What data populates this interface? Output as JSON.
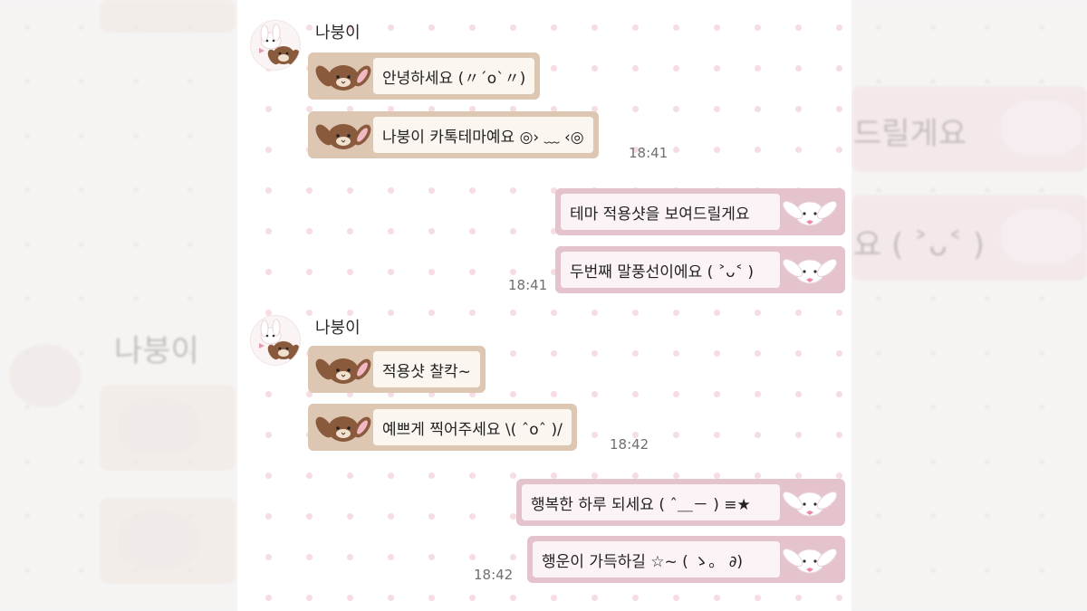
{
  "chat": {
    "groups": [
      {
        "sender": "나붕이",
        "messages": [
          {
            "text": "안녕하세요 (〃ˊoˋ〃)"
          },
          {
            "text": "나붕이 카톡테마예요 ◎› ﹏ ‹◎",
            "time": "18:41"
          }
        ]
      },
      {
        "sender": "me",
        "messages": [
          {
            "text": "테마 적용샷을 보여드릴게요"
          },
          {
            "text": "두번째 말풍선이에요 ( ˃ᴗ˂ )",
            "time": "18:41"
          }
        ]
      },
      {
        "sender": "나붕이",
        "messages": [
          {
            "text": "적용샷 찰칵~"
          },
          {
            "text": "예쁘게 찍어주세요 \\( ˆoˆ )/",
            "time": "18:42"
          }
        ]
      },
      {
        "sender": "me",
        "messages": [
          {
            "text": "행복한 하루 되세요 ( ˆ＿－ ) ≡★"
          },
          {
            "text": "행운이 가득하길 ☆~ ( ゝ。 ∂)",
            "time": "18:42"
          }
        ]
      }
    ]
  },
  "backdrop": {
    "left_name": "나붕이",
    "right_snippet_1": "드릴게요",
    "right_snippet_2": "요 ( ˃ᴗ˂ )"
  },
  "colors": {
    "incoming_bubble": "#ddc6b2",
    "outgoing_bubble": "#e4c3cc",
    "pattern_dot": "#f6dde2"
  },
  "icons": {
    "profile": "bunny-pair-avatar",
    "incoming_badge": "brown-bunny-face",
    "outgoing_badge": "white-bunny-face"
  }
}
